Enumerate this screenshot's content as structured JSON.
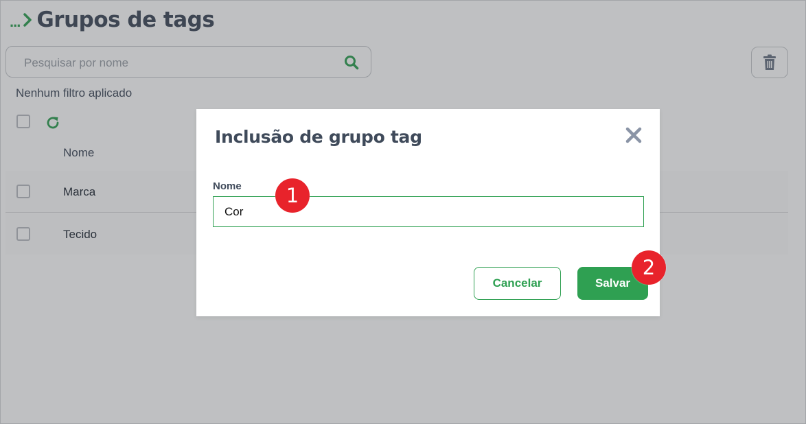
{
  "breadcrumb": {
    "ellipsis": "...",
    "title": "Grupos de tags"
  },
  "search": {
    "placeholder": "Pesquisar por nome",
    "value": ""
  },
  "filters": {
    "status_text": "Nenhum filtro aplicado"
  },
  "table": {
    "column_header": "Nome",
    "rows": [
      {
        "label": "Marca"
      },
      {
        "label": "Tecido"
      }
    ]
  },
  "modal": {
    "title": "Inclusão de grupo tag",
    "field_label": "Nome",
    "field_value": "Cor",
    "cancel_label": "Cancelar",
    "save_label": "Salvar"
  },
  "annotations": {
    "step1": "1",
    "step2": "2"
  },
  "colors": {
    "accent": "#2fa052",
    "text_dark": "#3f4a5a",
    "badge": "#e8232b",
    "close_icon": "#8a94a6"
  },
  "icons": {
    "breadcrumb": "chevron-right-icon",
    "search": "search-icon",
    "trash": "trash-icon",
    "refresh": "refresh-icon",
    "close": "close-icon"
  }
}
